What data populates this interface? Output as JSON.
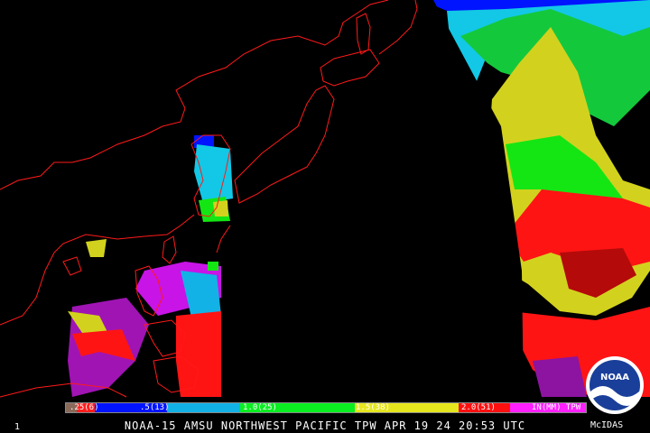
{
  "title": "NOAA-15 AMSU NORTHWEST PACIFIC TPW APR 19 24 20:53 UTC",
  "frame_number": "1",
  "credit": "McIDAS",
  "logo_text": "NOAA",
  "legend": {
    "segments": [
      {
        "color": "#8a6a5a",
        "frac": 0.02
      },
      {
        "color": "#ff1e1e",
        "frac": 0.035
      },
      {
        "color": "#0014ff",
        "frac": 0.14
      },
      {
        "color": "#12b2e6",
        "frac": 0.14
      },
      {
        "color": "#0aee22",
        "frac": 0.22
      },
      {
        "color": "#e6e61e",
        "frac": 0.2
      },
      {
        "color": "#ff1010",
        "frac": 0.1
      },
      {
        "color": "#ff20ff",
        "frac": 0.145
      }
    ],
    "labels": [
      ".25(6)",
      ".5(13)",
      "1.0(25)",
      "1.5(38)",
      "2.0(51)",
      "IN(MM) TPW"
    ]
  },
  "colors": {
    "coastline": "#ff1a1a",
    "no_data": "#000000",
    "dry_blue": "#0014ff",
    "cyan": "#12c8e6",
    "green": "#14e614",
    "yellow": "#d2d21e",
    "red": "#ff1414",
    "magenta": "#c814e6"
  }
}
